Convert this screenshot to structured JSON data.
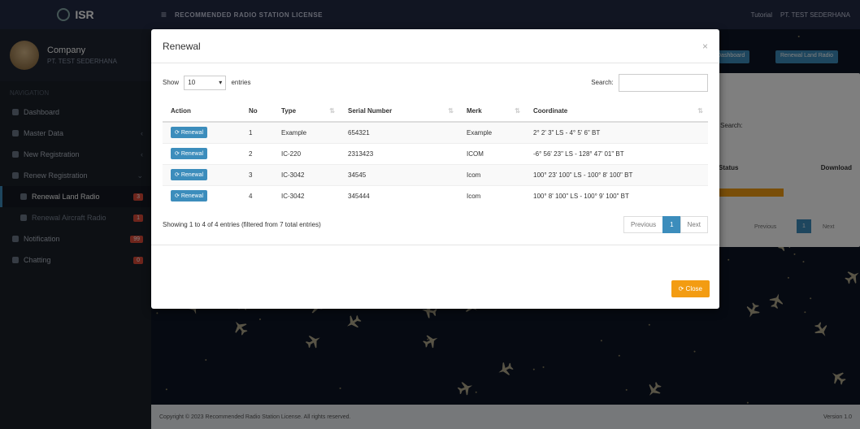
{
  "app": {
    "logo": "ISR",
    "title": "RECOMMENDED RADIO STATION LICENSE"
  },
  "topbar": {
    "tutorial": "Tutorial",
    "org": "PT. TEST SEDERHANA"
  },
  "user": {
    "name": "Company",
    "role": "PT. TEST SEDERHANA"
  },
  "sidebar": {
    "header": "NAVIGATION",
    "items": [
      {
        "label": "Dashboard"
      },
      {
        "label": "Master Data"
      },
      {
        "label": "New Registration"
      },
      {
        "label": "Renew Registration"
      },
      {
        "label": "Renewal Land Radio",
        "badge": "3"
      },
      {
        "label": "Renewal Aircraft Radio",
        "badge": "1"
      },
      {
        "label": "Notification",
        "badge": "99"
      },
      {
        "label": "Chatting",
        "badge": "0"
      }
    ]
  },
  "background": {
    "btn_dashboard": "Dashboard",
    "btn_renew": "Renewal Land Radio",
    "search_label": "Search:",
    "col_status": "Status",
    "col_download": "Download",
    "prev": "Previous",
    "page": "1",
    "next": "Next"
  },
  "footer": {
    "text": "Copyright © 2023 Recommended Radio Station License. All rights reserved.",
    "version": "Version 1.0"
  },
  "modal": {
    "title": "Renewal",
    "show_label": "Show",
    "entries_value": "10",
    "entries_label": "entries",
    "search_label": "Search:",
    "columns": [
      "Action",
      "No",
      "Type",
      "Serial Number",
      "Merk",
      "Coordinate"
    ],
    "rows": [
      {
        "action": "Renewal",
        "no": "1",
        "type": "Example",
        "serial": "654321",
        "merk": "Example",
        "coord": "2° 2' 3\" LS - 4° 5' 6\" BT"
      },
      {
        "action": "Renewal",
        "no": "2",
        "type": "IC-220",
        "serial": "2313423",
        "merk": "ICOM",
        "coord": "-6° 56' 23\" LS - 128° 47' 01\" BT"
      },
      {
        "action": "Renewal",
        "no": "3",
        "type": "IC-3042",
        "serial": "34545",
        "merk": "Icom",
        "coord": "100° 23' 100\" LS - 100° 8' 100\" BT"
      },
      {
        "action": "Renewal",
        "no": "4",
        "type": "IC-3042",
        "serial": "345444",
        "merk": "Icom",
        "coord": "100° 8' 100\" LS - 100° 9' 100\" BT"
      }
    ],
    "showing": "Showing 1 to 4 of 4 entries (filtered from 7 total entries)",
    "prev": "Previous",
    "page": "1",
    "next": "Next",
    "close_btn": "Close"
  }
}
